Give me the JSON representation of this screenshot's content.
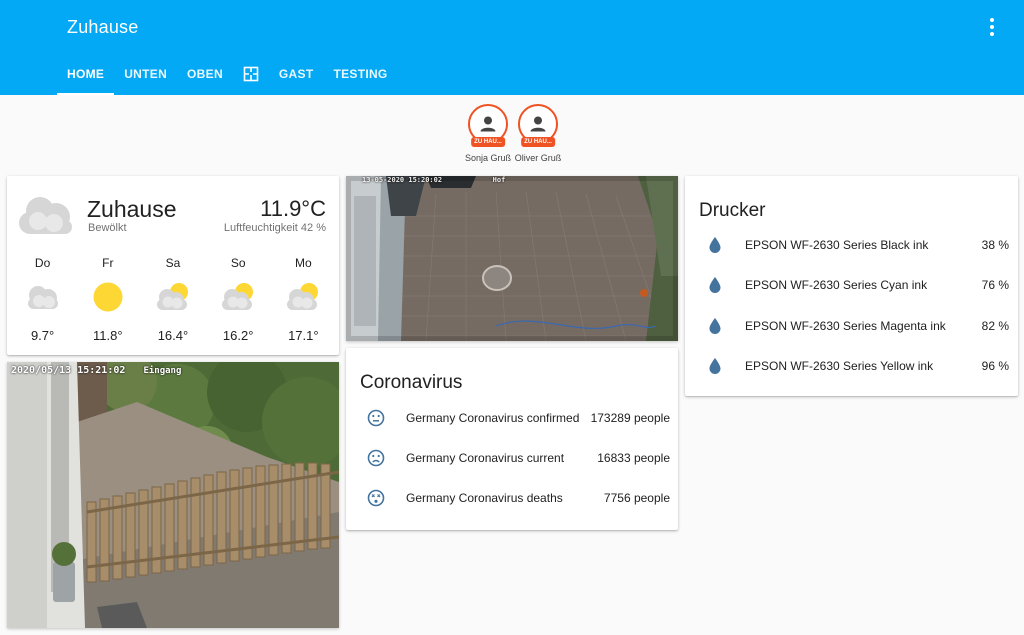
{
  "header": {
    "title": "Zuhause",
    "tabs": [
      {
        "label": "HOME",
        "active": true
      },
      {
        "label": "UNTEN"
      },
      {
        "label": "OBEN"
      },
      {
        "icon": "floorplan-icon"
      },
      {
        "label": "GAST"
      },
      {
        "label": "TESTING"
      }
    ]
  },
  "badges": [
    {
      "name": "Sonja Gruß",
      "state": "ZU HAU..."
    },
    {
      "name": "Oliver Gruß",
      "state": "ZU HAU..."
    }
  ],
  "weather": {
    "location": "Zuhause",
    "condition": "Bewölkt",
    "temperature": "11.9°C",
    "humidity": "Luftfeuchtigkeit 42 %",
    "forecast": [
      {
        "day": "Do",
        "icon": "cloudy-icon",
        "temp": "9.7°"
      },
      {
        "day": "Fr",
        "icon": "sunny-icon",
        "temp": "11.8°"
      },
      {
        "day": "Sa",
        "icon": "partly-cloudy-icon",
        "temp": "16.4°"
      },
      {
        "day": "So",
        "icon": "partly-cloudy-icon",
        "temp": "16.2°"
      },
      {
        "day": "Mo",
        "icon": "partly-cloudy-icon",
        "temp": "17.1°"
      }
    ]
  },
  "cameras": {
    "hof": {
      "timestamp": "13-05-2020 15:20:02",
      "label": "Hof"
    },
    "eingang": {
      "timestamp": "2020/05/13 15:21:02",
      "label": "Eingang"
    }
  },
  "corona": {
    "title": "Coronavirus",
    "rows": [
      {
        "icon": "emoticon-neutral-icon",
        "name": "Germany Coronavirus confirmed",
        "value": "173289 people"
      },
      {
        "icon": "emoticon-sad-icon",
        "name": "Germany Coronavirus current",
        "value": "16833 people"
      },
      {
        "icon": "emoticon-dead-icon",
        "name": "Germany Coronavirus deaths",
        "value": "7756 people"
      }
    ]
  },
  "drucker": {
    "title": "Drucker",
    "rows": [
      {
        "icon": "water-drop-icon",
        "name": "EPSON WF-2630 Series Black ink",
        "value": "38 %"
      },
      {
        "icon": "water-drop-icon",
        "name": "EPSON WF-2630 Series Cyan ink",
        "value": "76 %"
      },
      {
        "icon": "water-drop-icon",
        "name": "EPSON WF-2630 Series Magenta ink",
        "value": "82 %"
      },
      {
        "icon": "water-drop-icon",
        "name": "EPSON WF-2630 Series Yellow ink",
        "value": "96 %"
      }
    ]
  },
  "colors": {
    "header": "#03a9f4",
    "badge": "#ef5323",
    "icon": "#44739e",
    "sun": "#fdd835"
  }
}
